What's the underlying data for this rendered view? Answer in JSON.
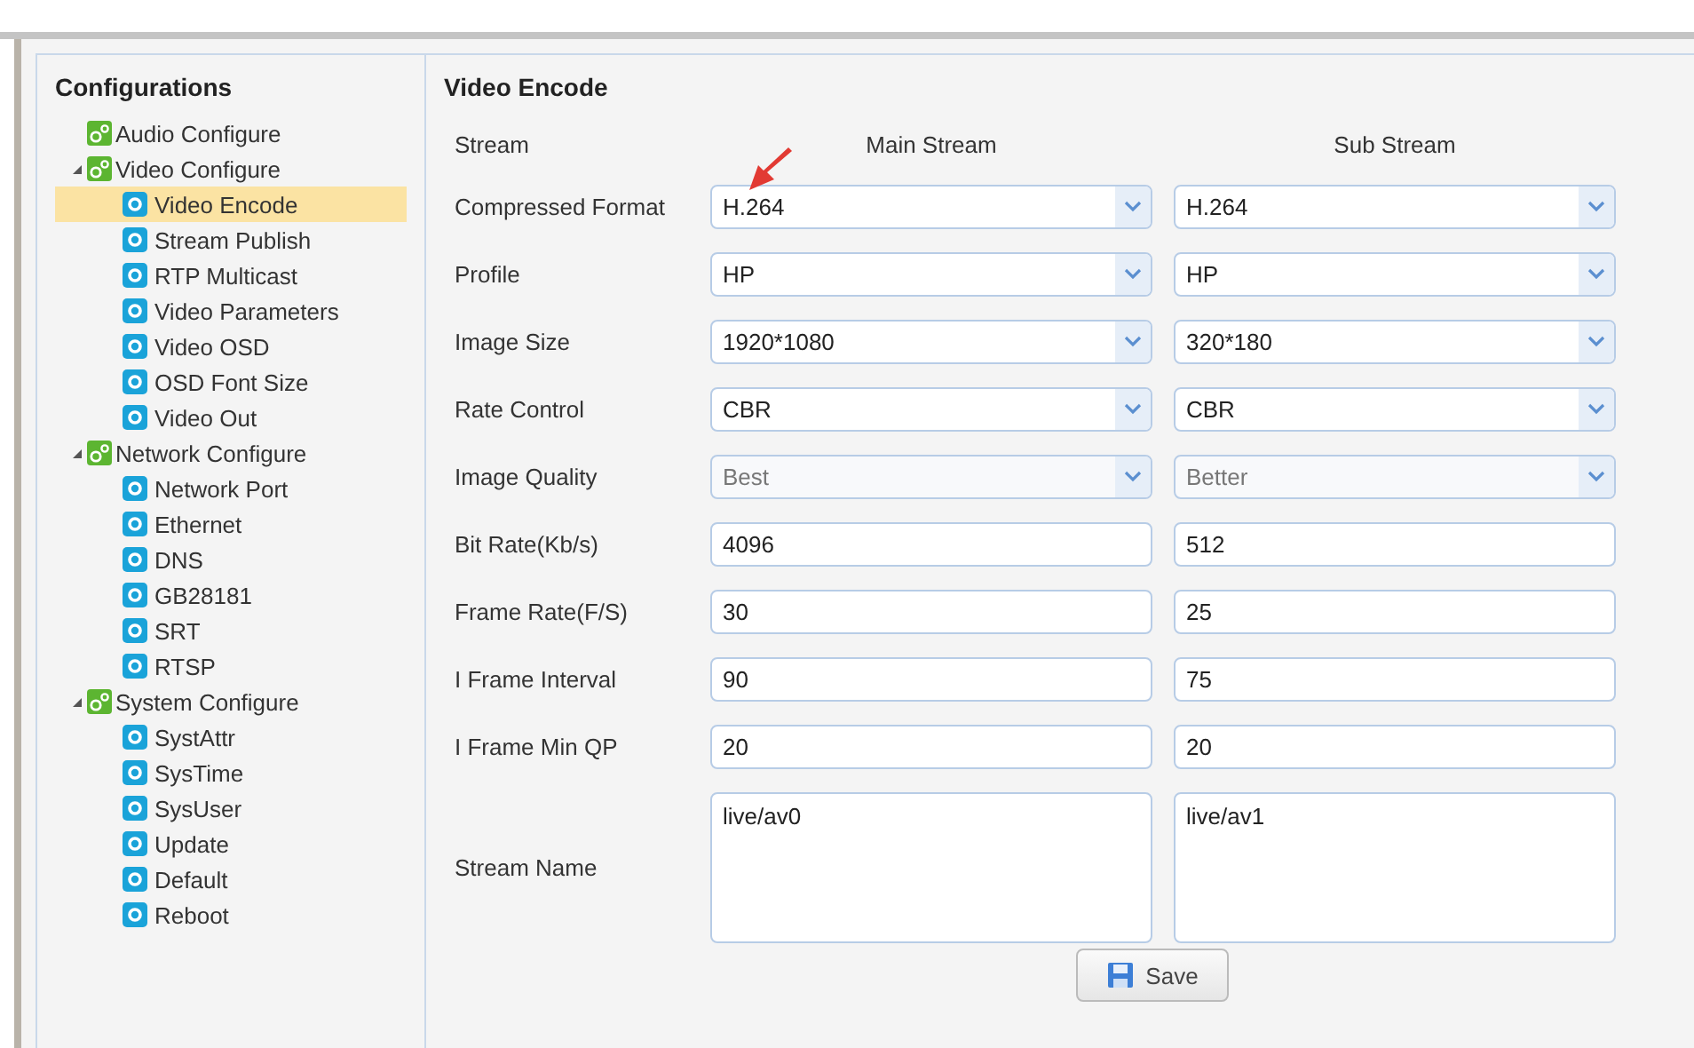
{
  "sidebar": {
    "title": "Configurations",
    "tree": [
      {
        "label": "Audio Configure",
        "expanded": false
      },
      {
        "label": "Video Configure",
        "expanded": true,
        "children": [
          {
            "label": "Video Encode",
            "selected": true
          },
          {
            "label": "Stream Publish",
            "selected": false
          },
          {
            "label": "RTP Multicast",
            "selected": false
          },
          {
            "label": "Video Parameters",
            "selected": false
          },
          {
            "label": "Video OSD",
            "selected": false
          },
          {
            "label": "OSD Font Size",
            "selected": false
          },
          {
            "label": "Video Out",
            "selected": false
          }
        ]
      },
      {
        "label": "Network Configure",
        "expanded": true,
        "children": [
          {
            "label": "Network Port",
            "selected": false
          },
          {
            "label": "Ethernet",
            "selected": false
          },
          {
            "label": "DNS",
            "selected": false
          },
          {
            "label": "GB28181",
            "selected": false
          },
          {
            "label": "SRT",
            "selected": false
          },
          {
            "label": "RTSP",
            "selected": false
          }
        ]
      },
      {
        "label": "System Configure",
        "expanded": true,
        "children": [
          {
            "label": "SystAttr",
            "selected": false
          },
          {
            "label": "SysTime",
            "selected": false
          },
          {
            "label": "SysUser",
            "selected": false
          },
          {
            "label": "Update",
            "selected": false
          },
          {
            "label": "Default",
            "selected": false
          },
          {
            "label": "Reboot",
            "selected": false
          }
        ]
      }
    ]
  },
  "main": {
    "title": "Video Encode",
    "columns": [
      "Stream",
      "Main Stream",
      "Sub Stream"
    ],
    "rows": [
      {
        "label": "Compressed Format",
        "kind": "select",
        "disabled": false,
        "main": "H.264",
        "sub": "H.264"
      },
      {
        "label": "Profile",
        "kind": "select",
        "disabled": false,
        "main": "HP",
        "sub": "HP"
      },
      {
        "label": "Image Size",
        "kind": "select",
        "disabled": false,
        "main": "1920*1080",
        "sub": "320*180"
      },
      {
        "label": "Rate Control",
        "kind": "select",
        "disabled": false,
        "main": "CBR",
        "sub": "CBR"
      },
      {
        "label": "Image Quality",
        "kind": "select",
        "disabled": true,
        "main": "Best",
        "sub": "Better"
      },
      {
        "label": "Bit Rate(Kb/s)",
        "kind": "text",
        "disabled": false,
        "main": "4096",
        "sub": "512"
      },
      {
        "label": "Frame Rate(F/S)",
        "kind": "text",
        "disabled": false,
        "main": "30",
        "sub": "25"
      },
      {
        "label": "I Frame Interval",
        "kind": "text",
        "disabled": false,
        "main": "90",
        "sub": "75"
      },
      {
        "label": "I Frame Min QP",
        "kind": "text",
        "disabled": false,
        "main": "20",
        "sub": "20"
      },
      {
        "label": "Stream Name",
        "kind": "textarea",
        "disabled": false,
        "main": "live/av0",
        "sub": "live/av1"
      }
    ],
    "save_button": "Save"
  }
}
